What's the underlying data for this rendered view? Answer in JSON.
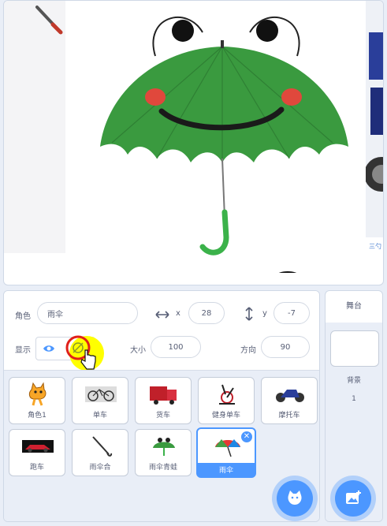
{
  "sprite_info": {
    "sprite_label": "角色",
    "sprite_name": "雨伞",
    "x_label": "x",
    "x_value": "28",
    "y_label": "y",
    "y_value": "-7",
    "show_label": "显示",
    "size_label": "大小",
    "size_value": "100",
    "direction_label": "方向",
    "direction_value": "90"
  },
  "sprites": [
    {
      "name": "角色1",
      "icon": "cat-sprite-icon"
    },
    {
      "name": "单车",
      "icon": "bicycle-icon"
    },
    {
      "name": "货车",
      "icon": "truck-icon"
    },
    {
      "name": "健身单车",
      "icon": "exercise-bike-icon"
    },
    {
      "name": "摩托车",
      "icon": "motorcycle-icon"
    },
    {
      "name": "跑车",
      "icon": "sports-car-icon"
    },
    {
      "name": "雨伞合",
      "icon": "closed-umbrella-icon"
    },
    {
      "name": "雨伞青蛙",
      "icon": "frog-umbrella-icon"
    },
    {
      "name": "雨伞",
      "icon": "umbrella-icon",
      "selected": true
    }
  ],
  "stage_panel": {
    "title": "舞台",
    "backdrop_label": "背景",
    "backdrop_count": "1"
  },
  "stage_right_text": "三勺",
  "colors": {
    "accent": "#4c97ff",
    "umbrella_green": "#3a9a3f",
    "highlight": "#ffff00",
    "cursor_ring": "#e0201a"
  }
}
